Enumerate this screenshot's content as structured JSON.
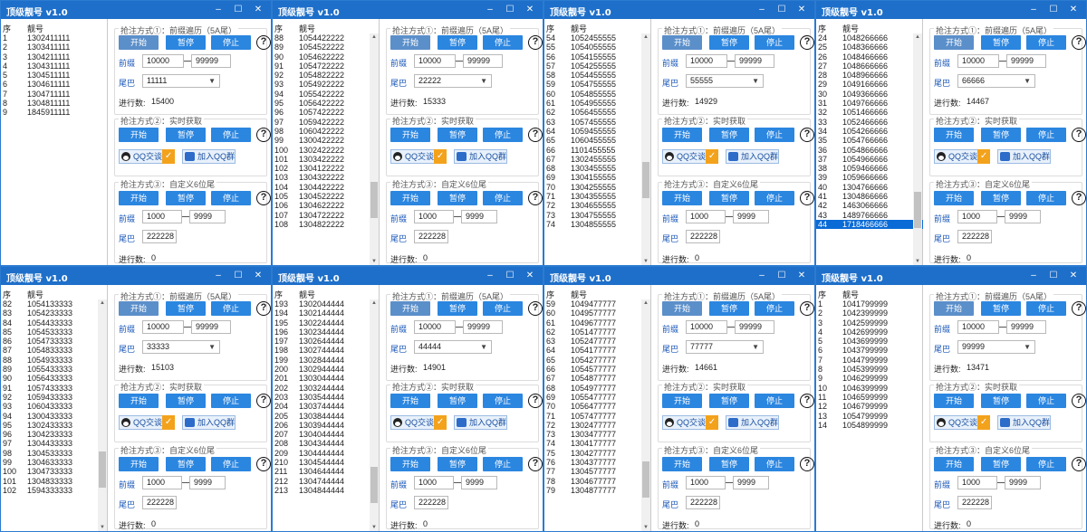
{
  "app_title": "顶级靓号 v1.0",
  "colors": {
    "titlebar": "#1e6fc9",
    "button": "#2b86e0",
    "selected_row": "#0a6bd6",
    "label": "#1a57b8"
  },
  "common": {
    "col_index": "序",
    "col_number": "靓号",
    "method1_title": "抢注方式①：前缀遍历（5A尾）",
    "method2_title": "抢注方式②：实时获取",
    "method3_title": "抢注方式③：自定义6位尾",
    "start": "开始",
    "pause": "暂停",
    "stop": "停止",
    "help": "?",
    "prefix_label": "前缀",
    "tail_label": "尾巴",
    "progress_label": "进行数:",
    "qq_chat": "QQ交谈",
    "join_group": "加入QQ群",
    "range1_from": "10000",
    "range1_to": "99999",
    "range3_from": "1000",
    "range3_to": "9999",
    "custom_tail": "222228",
    "progress3": "0",
    "min_icon": "–",
    "max_icon": "☐",
    "close_icon": "✕"
  },
  "windows": [
    {
      "tail": "11111",
      "progress": "15400",
      "rows": [
        [
          "1",
          "1302411111"
        ],
        [
          "2",
          "1303411111"
        ],
        [
          "3",
          "1304211111"
        ],
        [
          "4",
          "1304311111"
        ],
        [
          "5",
          "1304511111"
        ],
        [
          "6",
          "1304611111"
        ],
        [
          "7",
          "1304711111"
        ],
        [
          "8",
          "1304811111"
        ],
        [
          "9",
          "1845911111"
        ]
      ],
      "selected": -1,
      "scroll": null
    },
    {
      "tail": "22222",
      "progress": "15333",
      "rows": [
        [
          "88",
          "1054422222"
        ],
        [
          "89",
          "1054522222"
        ],
        [
          "90",
          "1054622222"
        ],
        [
          "91",
          "1054722222"
        ],
        [
          "92",
          "1054822222"
        ],
        [
          "93",
          "1054922222"
        ],
        [
          "94",
          "1055422222"
        ],
        [
          "95",
          "1056422222"
        ],
        [
          "96",
          "1057422222"
        ],
        [
          "97",
          "1059422222"
        ],
        [
          "98",
          "1060422222"
        ],
        [
          "99",
          "1300422222"
        ],
        [
          "100",
          "1302422222"
        ],
        [
          "101",
          "1303422222"
        ],
        [
          "102",
          "1304122222"
        ],
        [
          "103",
          "1304322222"
        ],
        [
          "104",
          "1304422222"
        ],
        [
          "105",
          "1304522222"
        ],
        [
          "106",
          "1304622222"
        ],
        [
          "107",
          "1304722222"
        ],
        [
          "108",
          "1304822222"
        ]
      ],
      "selected": -1,
      "scroll": 0.84
    },
    {
      "tail": "55555",
      "progress": "14929",
      "rows": [
        [
          "54",
          "1052455555"
        ],
        [
          "55",
          "1054055555"
        ],
        [
          "56",
          "1054155555"
        ],
        [
          "57",
          "1054255555"
        ],
        [
          "58",
          "1054455555"
        ],
        [
          "59",
          "1054755555"
        ],
        [
          "60",
          "1054855555"
        ],
        [
          "61",
          "1054955555"
        ],
        [
          "62",
          "1056455555"
        ],
        [
          "63",
          "1057455555"
        ],
        [
          "64",
          "1059455555"
        ],
        [
          "65",
          "1060455555"
        ],
        [
          "66",
          "1101455555"
        ],
        [
          "67",
          "1302455555"
        ],
        [
          "68",
          "1303455555"
        ],
        [
          "69",
          "1304155555"
        ],
        [
          "70",
          "1304255555"
        ],
        [
          "71",
          "1304355555"
        ],
        [
          "72",
          "1304655555"
        ],
        [
          "73",
          "1304755555"
        ],
        [
          "74",
          "1304855555"
        ]
      ],
      "selected": -1,
      "scroll": 0.72
    },
    {
      "tail": "66666",
      "progress": "14467",
      "rows": [
        [
          "24",
          "1048266666"
        ],
        [
          "25",
          "1048366666"
        ],
        [
          "26",
          "1048466666"
        ],
        [
          "27",
          "1048666666"
        ],
        [
          "28",
          "1048966666"
        ],
        [
          "29",
          "1049166666"
        ],
        [
          "30",
          "1049366666"
        ],
        [
          "31",
          "1049766666"
        ],
        [
          "32",
          "1051466666"
        ],
        [
          "33",
          "1052466666"
        ],
        [
          "34",
          "1054266666"
        ],
        [
          "35",
          "1054766666"
        ],
        [
          "36",
          "1054866666"
        ],
        [
          "37",
          "1054966666"
        ],
        [
          "38",
          "1059466666"
        ],
        [
          "39",
          "1059666666"
        ],
        [
          "40",
          "1304766666"
        ],
        [
          "41",
          "1304866666"
        ],
        [
          "42",
          "1463066666"
        ],
        [
          "43",
          "1489766666"
        ],
        [
          "44",
          "1718466666"
        ]
      ],
      "selected": 20,
      "scroll": 0.9
    },
    {
      "tail": "33333",
      "progress": "15103",
      "rows": [
        [
          "82",
          "1054133333"
        ],
        [
          "83",
          "1054233333"
        ],
        [
          "84",
          "1054433333"
        ],
        [
          "85",
          "1054533333"
        ],
        [
          "86",
          "1054733333"
        ],
        [
          "87",
          "1054833333"
        ],
        [
          "88",
          "1054933333"
        ],
        [
          "89",
          "1055433333"
        ],
        [
          "90",
          "1056433333"
        ],
        [
          "91",
          "1057433333"
        ],
        [
          "92",
          "1059433333"
        ],
        [
          "93",
          "1060433333"
        ],
        [
          "94",
          "1300433333"
        ],
        [
          "95",
          "1302433333"
        ],
        [
          "96",
          "1304233333"
        ],
        [
          "97",
          "1304433333"
        ],
        [
          "98",
          "1304533333"
        ],
        [
          "99",
          "1304633333"
        ],
        [
          "100",
          "1304733333"
        ],
        [
          "101",
          "1304833333"
        ],
        [
          "102",
          "1594333333"
        ]
      ],
      "selected": -1,
      "scroll": 0.86
    },
    {
      "tail": "44444",
      "progress": "14901",
      "rows": [
        [
          "193",
          "1302044444"
        ],
        [
          "194",
          "1302144444"
        ],
        [
          "195",
          "1302244444"
        ],
        [
          "196",
          "1302344444"
        ],
        [
          "197",
          "1302644444"
        ],
        [
          "198",
          "1302744444"
        ],
        [
          "199",
          "1302844444"
        ],
        [
          "200",
          "1302944444"
        ],
        [
          "201",
          "1303044444"
        ],
        [
          "202",
          "1303244444"
        ],
        [
          "203",
          "1303544444"
        ],
        [
          "204",
          "1303744444"
        ],
        [
          "205",
          "1303844444"
        ],
        [
          "206",
          "1303944444"
        ],
        [
          "207",
          "1304044444"
        ],
        [
          "208",
          "1304344444"
        ],
        [
          "209",
          "1304444444"
        ],
        [
          "210",
          "1304544444"
        ],
        [
          "211",
          "1304644444"
        ],
        [
          "212",
          "1304744444"
        ],
        [
          "213",
          "1304844444"
        ]
      ],
      "selected": -1,
      "scroll": 0.95
    },
    {
      "tail": "77777",
      "progress": "14661",
      "rows": [
        [
          "59",
          "1049477777"
        ],
        [
          "60",
          "1049577777"
        ],
        [
          "61",
          "1049677777"
        ],
        [
          "62",
          "1051477777"
        ],
        [
          "63",
          "1052477777"
        ],
        [
          "64",
          "1054177777"
        ],
        [
          "65",
          "1054277777"
        ],
        [
          "66",
          "1054577777"
        ],
        [
          "67",
          "1054877777"
        ],
        [
          "68",
          "1054977777"
        ],
        [
          "69",
          "1055477777"
        ],
        [
          "70",
          "1056477777"
        ],
        [
          "71",
          "1057477777"
        ],
        [
          "72",
          "1302477777"
        ],
        [
          "73",
          "1303477777"
        ],
        [
          "74",
          "1304177777"
        ],
        [
          "75",
          "1304277777"
        ],
        [
          "76",
          "1304377777"
        ],
        [
          "77",
          "1304577777"
        ],
        [
          "78",
          "1304677777"
        ],
        [
          "79",
          "1304877777"
        ]
      ],
      "selected": -1,
      "scroll": 0.92
    },
    {
      "tail": "99999",
      "progress": "13471",
      "rows": [
        [
          "1",
          "1041799999"
        ],
        [
          "2",
          "1042399999"
        ],
        [
          "3",
          "1042599999"
        ],
        [
          "4",
          "1042699999"
        ],
        [
          "5",
          "1043699999"
        ],
        [
          "6",
          "1043799999"
        ],
        [
          "7",
          "1044799999"
        ],
        [
          "8",
          "1045399999"
        ],
        [
          "9",
          "1046299999"
        ],
        [
          "10",
          "1046399999"
        ],
        [
          "11",
          "1046599999"
        ],
        [
          "12",
          "1046799999"
        ],
        [
          "13",
          "1054799999"
        ],
        [
          "14",
          "1054899999"
        ]
      ],
      "selected": -1,
      "scroll": null
    }
  ]
}
